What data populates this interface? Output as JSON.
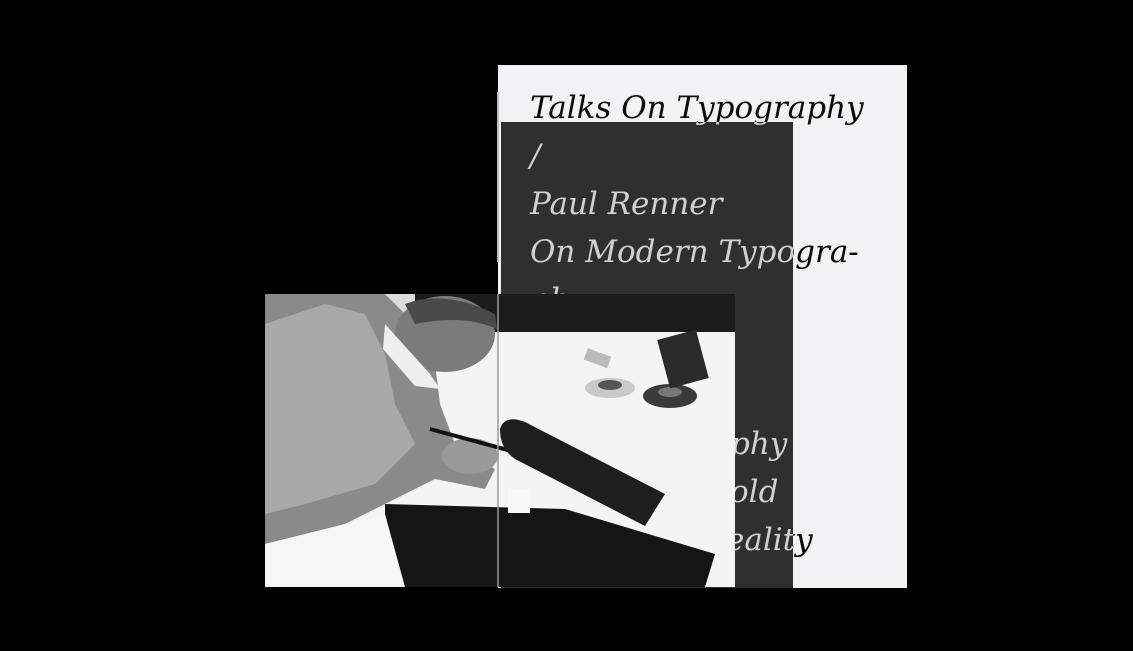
{
  "cover": {
    "lines": [
      "Talks On Typography",
      "/",
      "Paul Renner",
      "On Modern Typogra-",
      "phy",
      "",
      "",
      "phy",
      "old",
      "eality"
    ]
  },
  "colors": {
    "background": "#000000",
    "sheet_white": "#f2f1f3",
    "sheet_dark": "#2f2f2f"
  }
}
